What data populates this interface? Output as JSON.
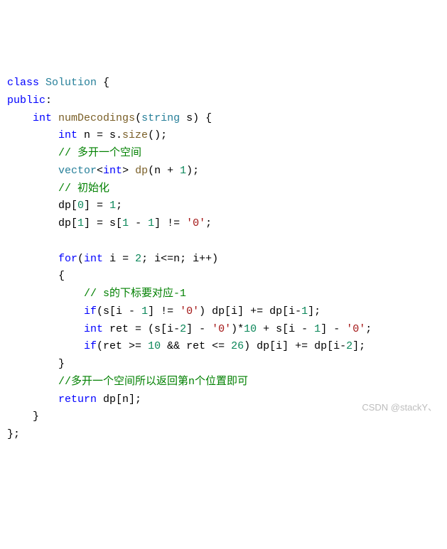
{
  "code": {
    "tokens": {
      "class_kw": "class",
      "Solution": "Solution",
      "public_kw": "public",
      "int_kw": "int",
      "numDecodings": "numDecodings",
      "string_type": "string",
      "s_param": "s",
      "n_var": "n",
      "size_fn": "size",
      "comment1": "// 多开一个空间",
      "vector_type": "vector",
      "dp_var": "dp",
      "plus1": "1",
      "comment2": "// 初始化",
      "zero": "0",
      "one": "1",
      "one_b": "1",
      "one_c": "1",
      "char0": "'0'",
      "for_kw": "for",
      "i_var": "i",
      "two": "2",
      "comment3": "// s的下标要对应-1",
      "if_kw": "if",
      "char0b": "'0'",
      "ret_var": "ret",
      "char0c": "'0'",
      "ten": "10",
      "char0d": "'0'",
      "ten_b": "10",
      "twenty6": "26",
      "comment4": "//多开一个空间所以返回第n个位置即可",
      "return_kw": "return"
    }
  },
  "watermark": "CSDN @stackY、"
}
